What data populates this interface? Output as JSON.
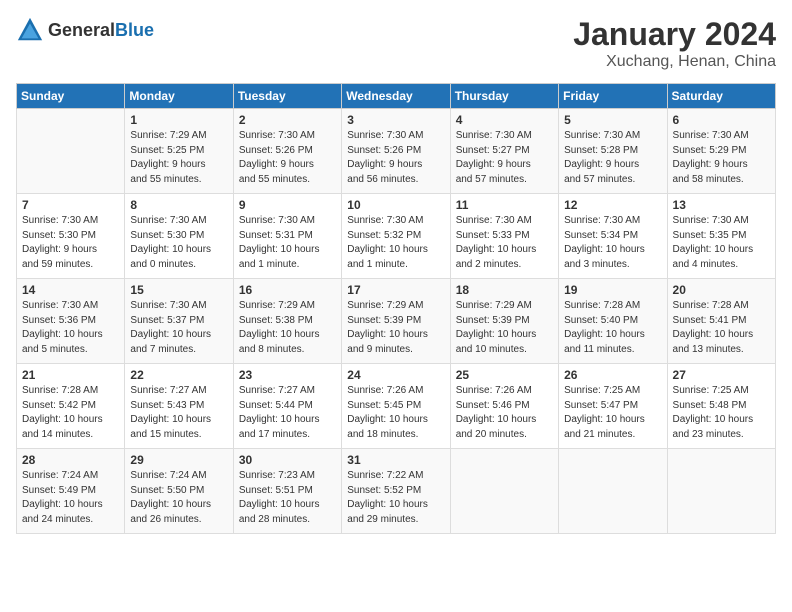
{
  "header": {
    "logo_general": "General",
    "logo_blue": "Blue",
    "month": "January 2024",
    "location": "Xuchang, Henan, China"
  },
  "days_of_week": [
    "Sunday",
    "Monday",
    "Tuesday",
    "Wednesday",
    "Thursday",
    "Friday",
    "Saturday"
  ],
  "weeks": [
    [
      {
        "day": "",
        "info": ""
      },
      {
        "day": "1",
        "info": "Sunrise: 7:29 AM\nSunset: 5:25 PM\nDaylight: 9 hours\nand 55 minutes."
      },
      {
        "day": "2",
        "info": "Sunrise: 7:30 AM\nSunset: 5:26 PM\nDaylight: 9 hours\nand 55 minutes."
      },
      {
        "day": "3",
        "info": "Sunrise: 7:30 AM\nSunset: 5:26 PM\nDaylight: 9 hours\nand 56 minutes."
      },
      {
        "day": "4",
        "info": "Sunrise: 7:30 AM\nSunset: 5:27 PM\nDaylight: 9 hours\nand 57 minutes."
      },
      {
        "day": "5",
        "info": "Sunrise: 7:30 AM\nSunset: 5:28 PM\nDaylight: 9 hours\nand 57 minutes."
      },
      {
        "day": "6",
        "info": "Sunrise: 7:30 AM\nSunset: 5:29 PM\nDaylight: 9 hours\nand 58 minutes."
      }
    ],
    [
      {
        "day": "7",
        "info": "Sunrise: 7:30 AM\nSunset: 5:30 PM\nDaylight: 9 hours\nand 59 minutes."
      },
      {
        "day": "8",
        "info": "Sunrise: 7:30 AM\nSunset: 5:30 PM\nDaylight: 10 hours\nand 0 minutes."
      },
      {
        "day": "9",
        "info": "Sunrise: 7:30 AM\nSunset: 5:31 PM\nDaylight: 10 hours\nand 1 minute."
      },
      {
        "day": "10",
        "info": "Sunrise: 7:30 AM\nSunset: 5:32 PM\nDaylight: 10 hours\nand 1 minute."
      },
      {
        "day": "11",
        "info": "Sunrise: 7:30 AM\nSunset: 5:33 PM\nDaylight: 10 hours\nand 2 minutes."
      },
      {
        "day": "12",
        "info": "Sunrise: 7:30 AM\nSunset: 5:34 PM\nDaylight: 10 hours\nand 3 minutes."
      },
      {
        "day": "13",
        "info": "Sunrise: 7:30 AM\nSunset: 5:35 PM\nDaylight: 10 hours\nand 4 minutes."
      }
    ],
    [
      {
        "day": "14",
        "info": "Sunrise: 7:30 AM\nSunset: 5:36 PM\nDaylight: 10 hours\nand 5 minutes."
      },
      {
        "day": "15",
        "info": "Sunrise: 7:30 AM\nSunset: 5:37 PM\nDaylight: 10 hours\nand 7 minutes."
      },
      {
        "day": "16",
        "info": "Sunrise: 7:29 AM\nSunset: 5:38 PM\nDaylight: 10 hours\nand 8 minutes."
      },
      {
        "day": "17",
        "info": "Sunrise: 7:29 AM\nSunset: 5:39 PM\nDaylight: 10 hours\nand 9 minutes."
      },
      {
        "day": "18",
        "info": "Sunrise: 7:29 AM\nSunset: 5:39 PM\nDaylight: 10 hours\nand 10 minutes."
      },
      {
        "day": "19",
        "info": "Sunrise: 7:28 AM\nSunset: 5:40 PM\nDaylight: 10 hours\nand 11 minutes."
      },
      {
        "day": "20",
        "info": "Sunrise: 7:28 AM\nSunset: 5:41 PM\nDaylight: 10 hours\nand 13 minutes."
      }
    ],
    [
      {
        "day": "21",
        "info": "Sunrise: 7:28 AM\nSunset: 5:42 PM\nDaylight: 10 hours\nand 14 minutes."
      },
      {
        "day": "22",
        "info": "Sunrise: 7:27 AM\nSunset: 5:43 PM\nDaylight: 10 hours\nand 15 minutes."
      },
      {
        "day": "23",
        "info": "Sunrise: 7:27 AM\nSunset: 5:44 PM\nDaylight: 10 hours\nand 17 minutes."
      },
      {
        "day": "24",
        "info": "Sunrise: 7:26 AM\nSunset: 5:45 PM\nDaylight: 10 hours\nand 18 minutes."
      },
      {
        "day": "25",
        "info": "Sunrise: 7:26 AM\nSunset: 5:46 PM\nDaylight: 10 hours\nand 20 minutes."
      },
      {
        "day": "26",
        "info": "Sunrise: 7:25 AM\nSunset: 5:47 PM\nDaylight: 10 hours\nand 21 minutes."
      },
      {
        "day": "27",
        "info": "Sunrise: 7:25 AM\nSunset: 5:48 PM\nDaylight: 10 hours\nand 23 minutes."
      }
    ],
    [
      {
        "day": "28",
        "info": "Sunrise: 7:24 AM\nSunset: 5:49 PM\nDaylight: 10 hours\nand 24 minutes."
      },
      {
        "day": "29",
        "info": "Sunrise: 7:24 AM\nSunset: 5:50 PM\nDaylight: 10 hours\nand 26 minutes."
      },
      {
        "day": "30",
        "info": "Sunrise: 7:23 AM\nSunset: 5:51 PM\nDaylight: 10 hours\nand 28 minutes."
      },
      {
        "day": "31",
        "info": "Sunrise: 7:22 AM\nSunset: 5:52 PM\nDaylight: 10 hours\nand 29 minutes."
      },
      {
        "day": "",
        "info": ""
      },
      {
        "day": "",
        "info": ""
      },
      {
        "day": "",
        "info": ""
      }
    ]
  ]
}
